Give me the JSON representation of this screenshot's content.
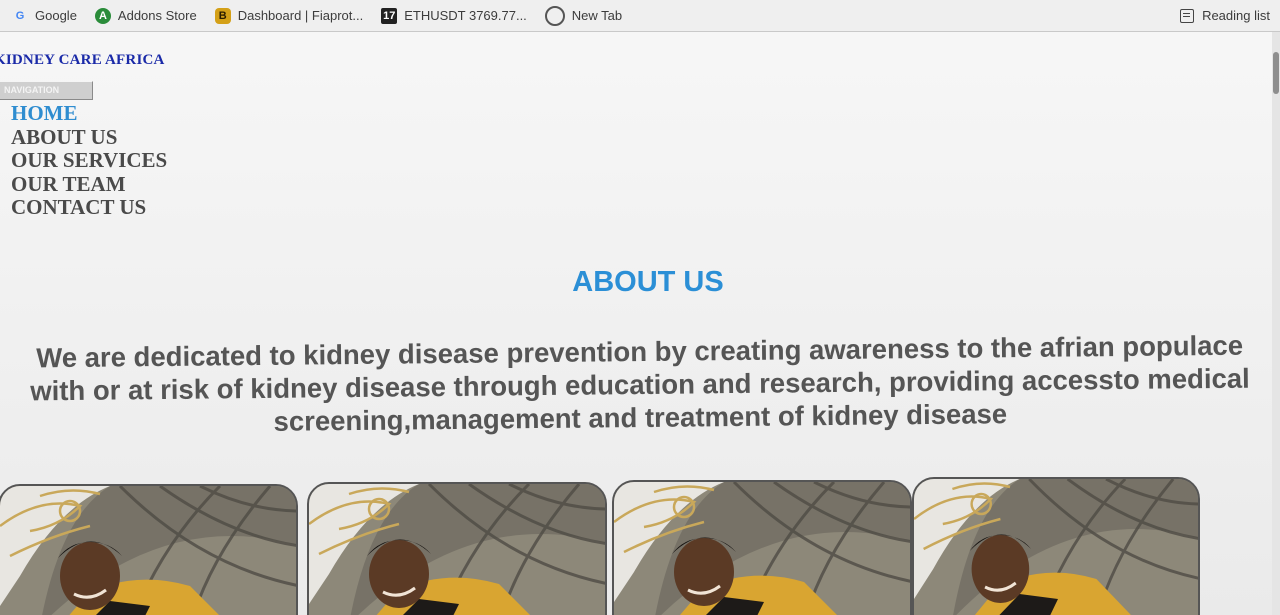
{
  "browser": {
    "bookmarks": [
      {
        "label": "Google",
        "icon": "google-icon"
      },
      {
        "label": "Addons Store",
        "icon": "addons-store-icon"
      },
      {
        "label": "Dashboard | Fiaprot...",
        "icon": "dashboard-icon"
      },
      {
        "label": "ETHUSDT 3769.77...",
        "icon": "tradingview-icon"
      },
      {
        "label": "New Tab",
        "icon": "globe-icon"
      }
    ],
    "reading_list": "Reading list"
  },
  "site": {
    "brand": "KIDNEY CARE AFRICA",
    "nav_toggle": "NAVIGATION",
    "nav": [
      {
        "label": "HOME",
        "active": true
      },
      {
        "label": "ABOUT US",
        "active": false
      },
      {
        "label": "OUR SERVICES",
        "active": false
      },
      {
        "label": "OUR TEAM",
        "active": false
      },
      {
        "label": "CONTACT US",
        "active": false
      }
    ]
  },
  "about": {
    "heading": "ABOUT US",
    "text": "We are dedicated to kidney disease prevention by creating awareness to the afrian populace with or at risk of kidney disease through education and research, providing accessto medical screening,management and treatment of kidney disease"
  },
  "colors": {
    "heading": "#2b8fd6",
    "nav_active": "#2f8dd0",
    "brand": "#1a2aa8",
    "body_text": "#555555"
  }
}
